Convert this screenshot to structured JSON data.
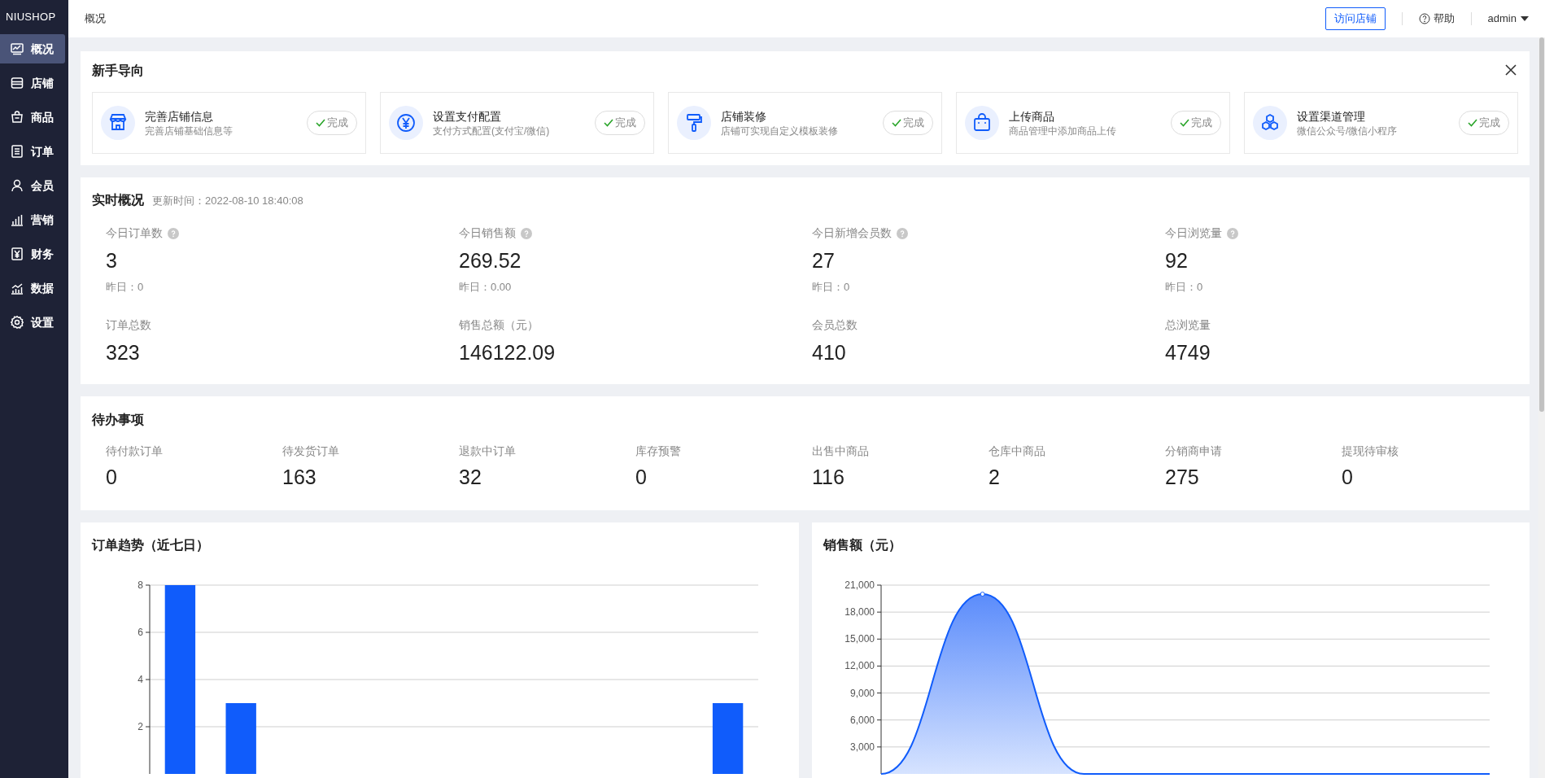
{
  "sidebar": {
    "logo": "NIUSHOP",
    "items": [
      {
        "label": "概况",
        "selected": true
      },
      {
        "label": "店铺",
        "selected": false
      },
      {
        "label": "商品",
        "selected": false
      },
      {
        "label": "订单",
        "selected": false
      },
      {
        "label": "会员",
        "selected": false
      },
      {
        "label": "营销",
        "selected": false
      },
      {
        "label": "财务",
        "selected": false
      },
      {
        "label": "数据",
        "selected": false
      },
      {
        "label": "设置",
        "selected": false
      }
    ]
  },
  "topbar": {
    "breadcrumb": "概况",
    "visit_button": "访问店铺",
    "help": "帮助",
    "user": "admin"
  },
  "guide": {
    "title": "新手导向",
    "steps": [
      {
        "title": "完善店铺信息",
        "desc": "完善店铺基础信息等",
        "status": "完成",
        "done": true
      },
      {
        "title": "设置支付配置",
        "desc": "支付方式配置(支付宝/微信)",
        "status": "完成",
        "done": true
      },
      {
        "title": "店铺装修",
        "desc": "店铺可实现自定义模板装修",
        "status": "完成",
        "done": true
      },
      {
        "title": "上传商品",
        "desc": "商品管理中添加商品上传",
        "status": "完成",
        "done": true
      },
      {
        "title": "设置渠道管理",
        "desc": "微信公众号/微信小程序",
        "status": "完成",
        "done": true
      }
    ]
  },
  "realtime": {
    "title": "实时概况",
    "updated": "更新时间：2022-08-10 18:40:08",
    "today": [
      {
        "label": "今日订单数",
        "value": "3",
        "yesterday": "昨日：0"
      },
      {
        "label": "今日销售额",
        "value": "269.52",
        "yesterday": "昨日：0.00"
      },
      {
        "label": "今日新增会员数",
        "value": "27",
        "yesterday": "昨日：0"
      },
      {
        "label": "今日浏览量",
        "value": "92",
        "yesterday": "昨日：0"
      }
    ],
    "totals": [
      {
        "label": "订单总数",
        "value": "323"
      },
      {
        "label": "销售总额（元）",
        "value": "146122.09"
      },
      {
        "label": "会员总数",
        "value": "410"
      },
      {
        "label": "总浏览量",
        "value": "4749"
      }
    ]
  },
  "todo": {
    "title": "待办事项",
    "items": [
      {
        "label": "待付款订单",
        "value": "0"
      },
      {
        "label": "待发货订单",
        "value": "163"
      },
      {
        "label": "退款中订单",
        "value": "32"
      },
      {
        "label": "库存预警",
        "value": "0"
      },
      {
        "label": "出售中商品",
        "value": "116"
      },
      {
        "label": "仓库中商品",
        "value": "2"
      },
      {
        "label": "分销商申请",
        "value": "275"
      },
      {
        "label": "提现待审核",
        "value": "0"
      }
    ]
  },
  "order_trend": {
    "title": "订单趋势（近七日）",
    "chart_data": {
      "type": "bar",
      "values": [
        8,
        3,
        0,
        0,
        0,
        0,
        0,
        0,
        0,
        3
      ],
      "grid": true,
      "ylim": [
        0,
        8
      ],
      "yticks": [
        2,
        4,
        6,
        8
      ]
    }
  },
  "sales": {
    "title": "销售额（元）",
    "chart_data": {
      "type": "area",
      "values": [
        0,
        20000,
        0,
        0,
        0,
        0,
        0
      ],
      "grid": true,
      "ylim": [
        0,
        21000
      ],
      "yticks": [
        {
          "value": 3000,
          "label": "3,000"
        },
        {
          "value": 6000,
          "label": "6,000"
        },
        {
          "value": 9000,
          "label": "9,000"
        },
        {
          "value": 12000,
          "label": "12,000"
        },
        {
          "value": 15000,
          "label": "15,000"
        },
        {
          "value": 18000,
          "label": "18,000"
        },
        {
          "value": 21000,
          "label": "21,000"
        }
      ]
    }
  }
}
